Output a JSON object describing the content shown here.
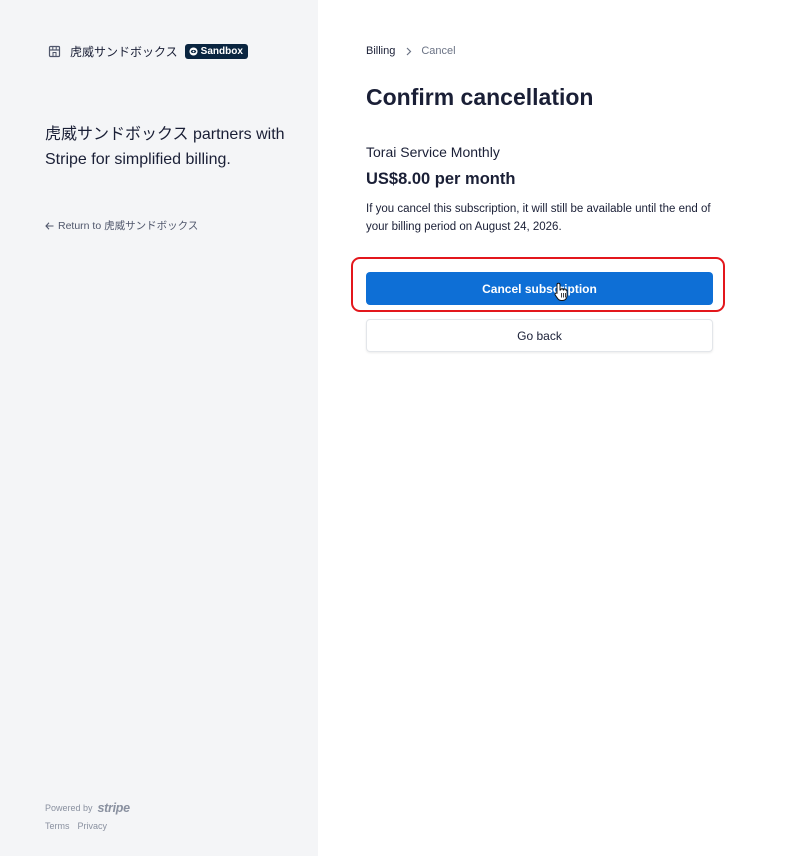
{
  "brand": {
    "name": "虎威サンドボックス",
    "sandbox_badge": "Sandbox",
    "icon": "store-icon"
  },
  "sidebar": {
    "tagline": "虎威サンドボックス partners with Stripe for simplified billing.",
    "return_link": "Return to 虎威サンドボックス",
    "powered_by": "Powered by",
    "stripe_logo": "stripe",
    "footer_terms": "Terms",
    "footer_privacy": "Privacy"
  },
  "breadcrumb": {
    "billing": "Billing",
    "cancel": "Cancel"
  },
  "main": {
    "title": "Confirm cancellation",
    "plan_name": "Torai Service Monthly",
    "plan_price": "US$8.00 per month",
    "notice": "If you cancel this subscription, it will still be available until the end of your billing period on August 24, 2026.",
    "cancel_button": "Cancel subscription",
    "back_button": "Go back"
  },
  "colors": {
    "sidebar_bg": "#f4f5f7",
    "primary": "#0e6fd6",
    "highlight": "#e3171c",
    "badge": "#0a2540"
  }
}
